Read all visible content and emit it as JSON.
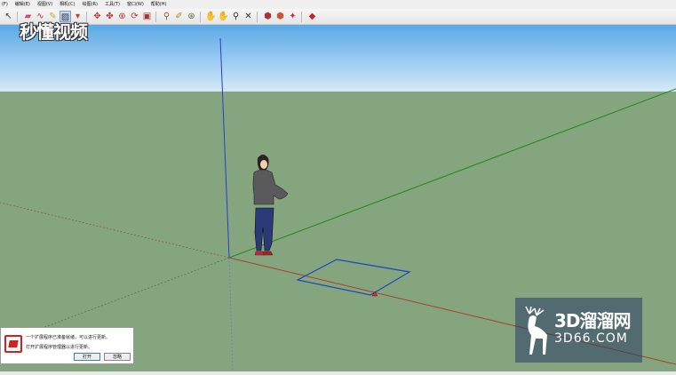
{
  "menubar": {
    "items": [
      "(F)",
      "编辑(E)",
      "视图(V)",
      "相机(C)",
      "绘图(R)",
      "工具(T)",
      "窗口(W)",
      "帮助(H)"
    ]
  },
  "toolbar": {
    "icons": [
      "select-icon",
      "eraser-icon",
      "freehand-icon",
      "pencil-icon",
      "paint-icon",
      "rectangle-icon",
      "pushpull-icon",
      "move-icon",
      "rotate-icon",
      "scale-icon",
      "offset-icon",
      "tape-icon",
      "dimension-icon",
      "protractor-icon",
      "text-icon",
      "orbit-icon",
      "pan-icon",
      "zoom-icon",
      "zoom-extents-icon",
      "warehouse-icon",
      "components-icon",
      "extensions-icon",
      "ruby-icon"
    ]
  },
  "watermark_top": {
    "text": "秒懂视频"
  },
  "notification": {
    "line1": "一个扩展程序已准备就绪，可以进行更新。",
    "line2": "打开扩展程序管理器以进行更新。",
    "open_button": "打开",
    "skip_button": "忽略"
  },
  "watermark_corner": {
    "title": "3D溜溜网",
    "subtitle": "3D66.COM"
  },
  "colors": {
    "sky_top": "#5aa8e6",
    "ground": "#85a57e",
    "axis_red": "#a8412f",
    "axis_green": "#1f8a1f",
    "axis_blue": "#2b3bd0",
    "rectangle_outline": "#2244bb"
  }
}
